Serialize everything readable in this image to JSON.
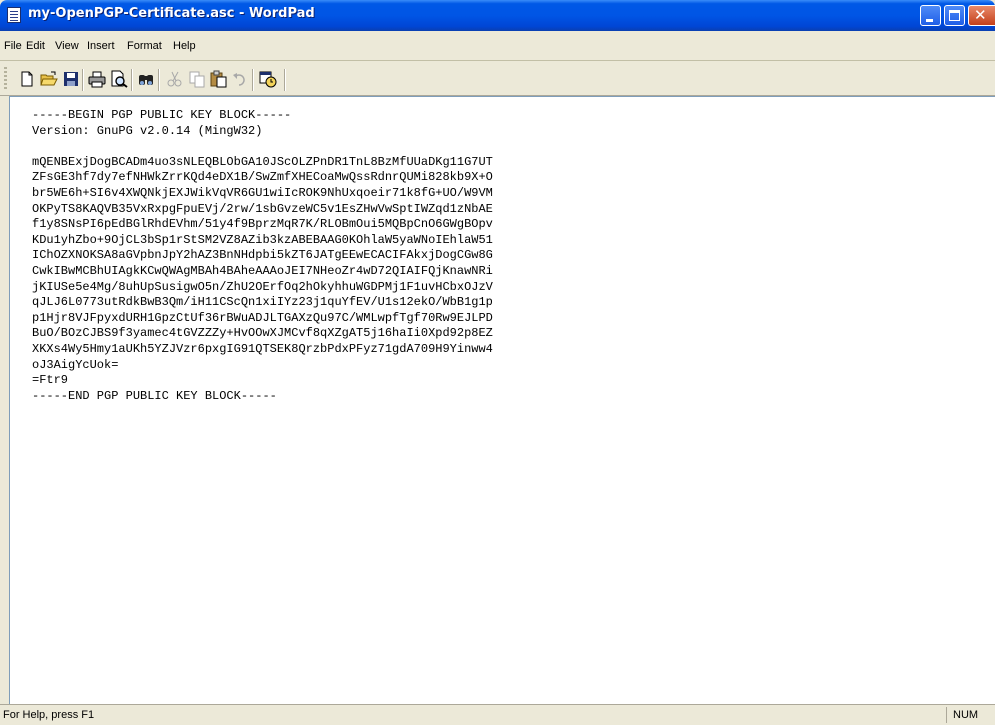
{
  "window": {
    "title": "my-OpenPGP-Certificate.asc - WordPad",
    "close_glyph": "✕"
  },
  "menu": {
    "items": [
      "File",
      "Edit",
      "View",
      "Insert",
      "Format",
      "Help"
    ]
  },
  "toolbar": {
    "icons": [
      "new-icon",
      "open-icon",
      "save-icon",
      "print-icon",
      "print-preview-icon",
      "find-icon",
      "cut-icon",
      "copy-icon",
      "paste-icon",
      "undo-icon",
      "date-time-icon"
    ]
  },
  "document": {
    "lines": [
      "-----BEGIN PGP PUBLIC KEY BLOCK-----",
      "Version: GnuPG v2.0.14 (MingW32)",
      "",
      "mQENBExjDogBCADm4uo3sNLEQBLObGA10JScOLZPnDR1TnL8BzMfUUaDKg11G7UT",
      "ZFsGE3hf7dy7efNHWkZrrKQd4eDX1B/SwZmfXHECoaMwQssRdnrQUMi828kb9X+O",
      "br5WE6h+SI6v4XWQNkjEXJWikVqVR6GU1wiIcROK9NhUxqoeir71k8fG+UO/W9VM",
      "OKPyTS8KAQVB35VxRxpgFpuEVj/2rw/1sbGvzeWC5v1EsZHwVwSptIWZqd1zNbAE",
      "f1y8SNsPI6pEdBGlRhdEVhm/51y4f9BprzMqR7K/RLOBmOui5MQBpCnO6GWgBOpv",
      "KDu1yhZbo+9OjCL3bSp1rStSM2VZ8AZib3kzABEBAAG0KOhlaW5yaWNoIEhlaW51",
      "IChOZXNOKSA8aGVpbnJpY2hAZ3BnNHdpbi5kZT6JATgEEwECACIFAkxjDogCGw8G",
      "CwkIBwMCBhUIAgkKCwQWAgMBAh4BAheAAAoJEI7NHeoZr4wD72QIAIFQjKnawNRi",
      "jKIUSe5e4Mg/8uhUpSusigwO5n/ZhU2OErfOq2hOkyhhuWGDPMj1F1uvHCbxOJzV",
      "qJLJ6L0773utRdkBwB3Qm/iH11CScQn1xiIYz23j1quYfEV/U1s12ekO/WbB1g1p",
      "p1Hjr8VJFpyxdURH1GpzCtUf36rBWuADJLTGAXzQu97C/WMLwpfTgf70Rw9EJLPD",
      "BuO/BOzCJBS9f3yamec4tGVZZZy+HvOOwXJMCvf8qXZgAT5j16haIi0Xpd92p8EZ",
      "XKXs4Wy5Hmy1aUKh5YZJVzr6pxgIG91QTSEK8QrzbPdxPFyz71gdA709H9Yinww4",
      "oJ3AigYcUok=",
      "=Ftr9",
      "-----END PGP PUBLIC KEY BLOCK-----"
    ]
  },
  "status": {
    "help_text": "For Help, press F1",
    "num_lock": "NUM"
  }
}
